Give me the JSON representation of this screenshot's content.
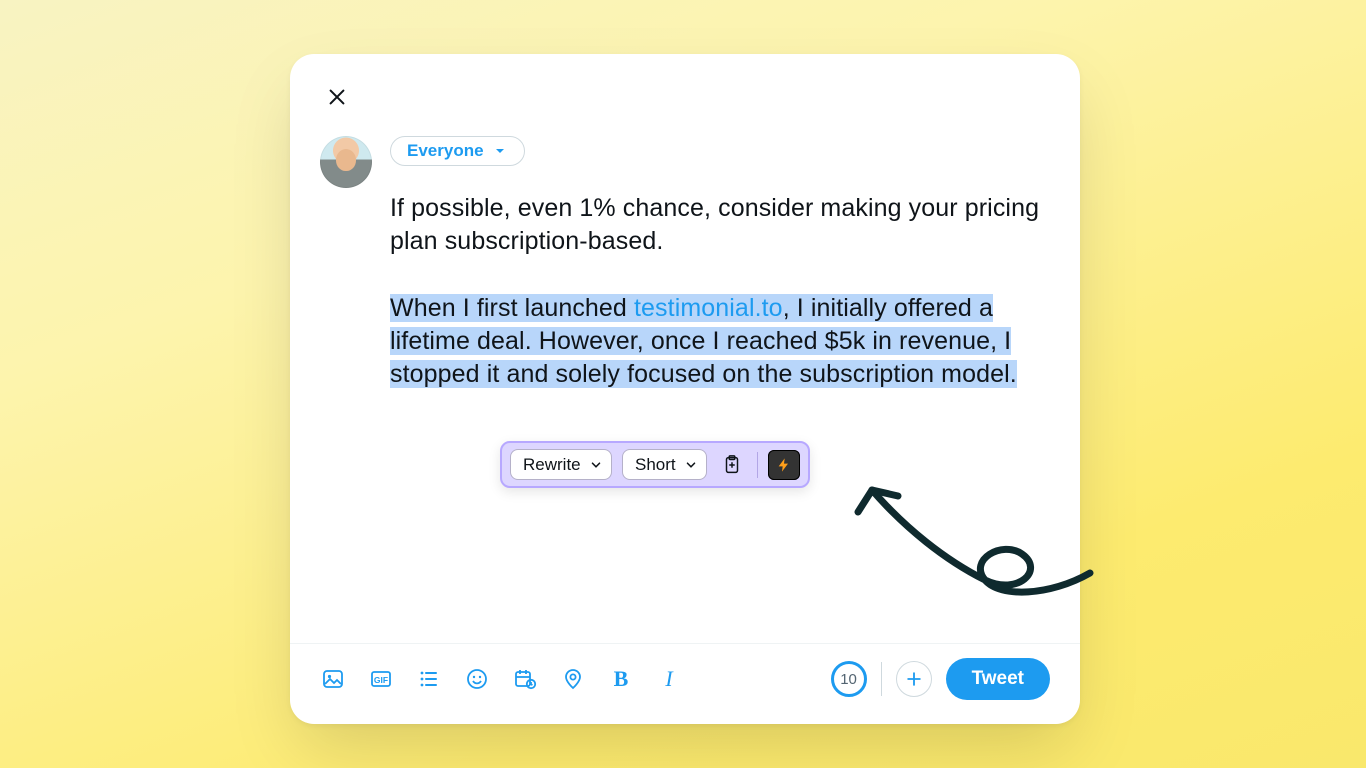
{
  "audience": {
    "label": "Everyone"
  },
  "composer": {
    "para1": "If possible, even 1% chance, consider making your pricing plan subscription-based.",
    "para2_a": "When I first launched ",
    "para2_link": "testimonial.to",
    "para2_b": ", I initially offered a lifetime deal. However, once I reached $5k in revenue, I stopped it and solely focused on the subscription model."
  },
  "ai_toolbar": {
    "mode": "Rewrite",
    "length": "Short"
  },
  "bottom": {
    "char_remaining": "10",
    "tweet_label": "Tweet"
  }
}
